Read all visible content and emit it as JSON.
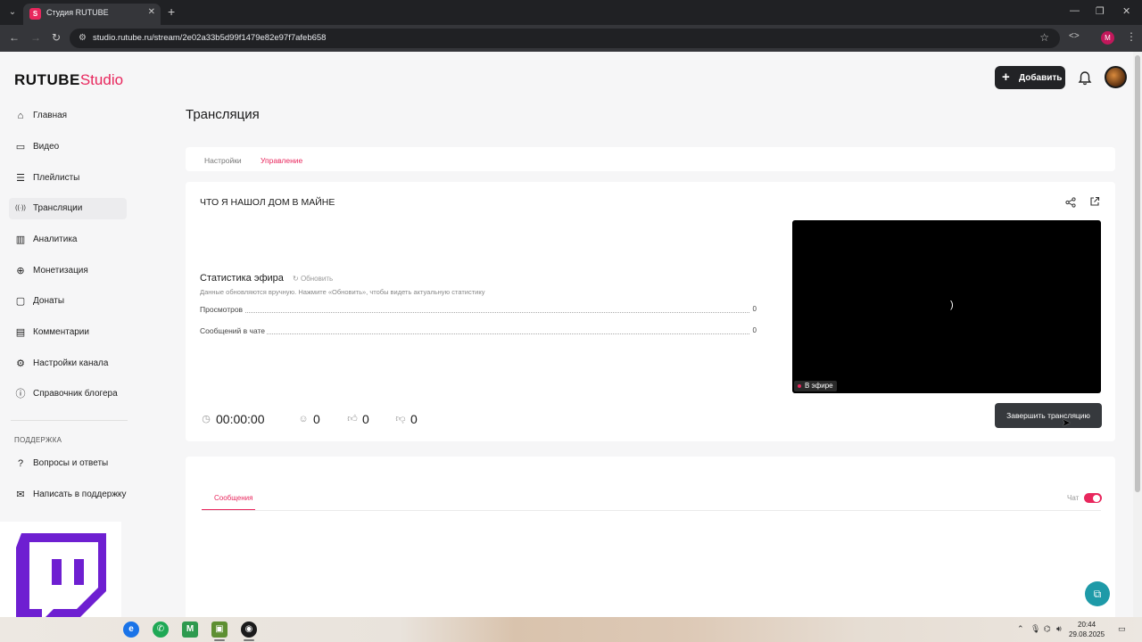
{
  "browser": {
    "tab_title": "Студия RUTUBE",
    "tab_close": "✕",
    "new_tab": "+",
    "url": "studio.rutube.ru/stream/2e02a33b5d99f1479e82e97f7afeb658"
  },
  "header": {
    "logo_rutube": "RUTUBE",
    "logo_studio": "Studio",
    "add_button": "Добавить",
    "add_plus": "+"
  },
  "sidebar": {
    "items": [
      {
        "label": "Главная",
        "icon": "home-icon",
        "glyph": "⌂"
      },
      {
        "label": "Видео",
        "icon": "video-icon",
        "glyph": "▭"
      },
      {
        "label": "Плейлисты",
        "icon": "playlist-icon",
        "glyph": "☰"
      },
      {
        "label": "Трансляции",
        "icon": "broadcast-icon",
        "glyph": "((·))",
        "active": true
      },
      {
        "label": "Аналитика",
        "icon": "analytics-icon",
        "glyph": "▥"
      },
      {
        "label": "Монетизация",
        "icon": "monetization-icon",
        "glyph": "⊕"
      },
      {
        "label": "Донаты",
        "icon": "donate-icon",
        "glyph": "▢"
      },
      {
        "label": "Комментарии",
        "icon": "comments-icon",
        "glyph": "▤"
      },
      {
        "label": "Настройки канала",
        "icon": "gear-icon",
        "glyph": "⚙"
      },
      {
        "label": "Справочник блогера",
        "icon": "help-icon",
        "glyph": "ⓘ"
      }
    ],
    "support_header": "ПОДДЕРЖКА",
    "support_items": [
      {
        "label": "Вопросы и ответы",
        "icon": "faq-icon",
        "glyph": "?"
      },
      {
        "label": "Написать в поддержку",
        "icon": "mail-icon",
        "glyph": "✉"
      }
    ]
  },
  "page": {
    "title": "Трансляция",
    "tabs": [
      "Настройки",
      "Управление"
    ],
    "active_tab": "Управление"
  },
  "stream": {
    "title": "ЧТО Я НАШОЛ ДОМ В МАЙНЕ",
    "stats_title": "Статистика эфира",
    "refresh_label": "Обновить",
    "stats_note": "Данные обновляются вручную. Нажмите «Обновить», чтобы видеть актуальную статистику",
    "stats": [
      {
        "label": "Просмотров",
        "value": "0"
      },
      {
        "label": "Сообщений в чате",
        "value": "0"
      }
    ],
    "live_label": "В эфире",
    "spinner": ")",
    "timer": "00:00:00",
    "viewers": "0",
    "likes": "0",
    "dislikes": "0",
    "end_button": "Завершить трансляцию"
  },
  "chat": {
    "tab_label": "Сообщения",
    "toggle_label": "Чат",
    "toggle_on": true
  },
  "taskbar": {
    "time": "20:44",
    "date": "29.08.2025"
  },
  "colors": {
    "accent": "#e8275d",
    "dark_button": "#222326",
    "twitch": "#6e1fd1"
  }
}
